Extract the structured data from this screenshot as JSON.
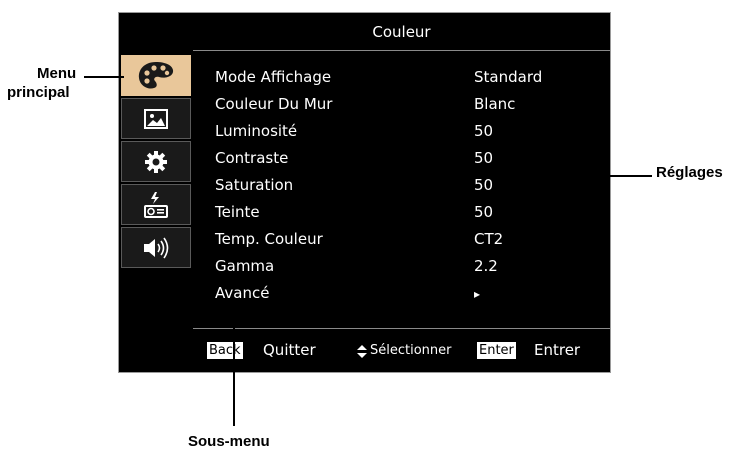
{
  "osd": {
    "title": "Couleur",
    "menu_items": [
      {
        "icon": "palette-icon",
        "active": true
      },
      {
        "icon": "image-icon",
        "active": false
      },
      {
        "icon": "gear-icon",
        "active": false
      },
      {
        "icon": "projector-icon",
        "active": false
      },
      {
        "icon": "speaker-icon",
        "active": false
      }
    ],
    "settings": [
      {
        "label": "Mode Affichage",
        "value": "Standard"
      },
      {
        "label": "Couleur Du Mur",
        "value": "Blanc"
      },
      {
        "label": "Luminosité",
        "value": "50"
      },
      {
        "label": "Contraste",
        "value": "50"
      },
      {
        "label": "Saturation",
        "value": "50"
      },
      {
        "label": "Teinte",
        "value": "50"
      },
      {
        "label": "Temp. Couleur",
        "value": "CT2"
      },
      {
        "label": "Gamma",
        "value": "2.2"
      },
      {
        "label": "Avancé",
        "value": "▸"
      }
    ],
    "footer": {
      "back_key": "Back",
      "back_label": "Quitter",
      "select_icon": "updown-icon",
      "select_label": "Sélectionner",
      "enter_key": "Enter",
      "enter_label": "Entrer"
    }
  },
  "callouts": {
    "menu_line1": "Menu",
    "menu_line2": "principal",
    "settings": "Réglages",
    "submenu": "Sous-menu"
  },
  "colors": {
    "active_tab": "#e9c79a",
    "background": "#000000",
    "text": "#ffffff"
  }
}
